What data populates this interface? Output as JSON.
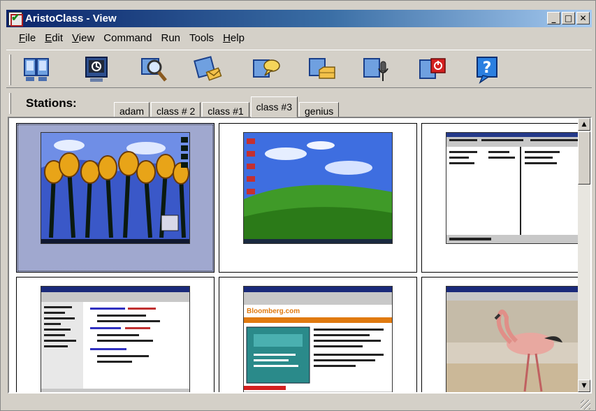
{
  "window": {
    "title": "AristoClass - View",
    "controls": {
      "minimize": "_",
      "maximize": "□",
      "close": "✕"
    }
  },
  "menu": [
    "File",
    "Edit",
    "View",
    "Command",
    "Run",
    "Tools",
    "Help"
  ],
  "toolbar": {
    "tools": [
      {
        "icon": "monitors-icon"
      },
      {
        "icon": "remote-control-icon"
      },
      {
        "icon": "magnifier-icon"
      },
      {
        "icon": "send-message-icon"
      },
      {
        "icon": "chat-icon"
      },
      {
        "icon": "send-files-icon"
      },
      {
        "icon": "audio-icon"
      },
      {
        "icon": "power-off-icon"
      },
      {
        "icon": "help-icon"
      }
    ]
  },
  "stations": {
    "label": "Stations:",
    "tabs": [
      "adam",
      "class # 2",
      "class #1",
      "class #3",
      "genius"
    ],
    "active_tab": "class #3"
  },
  "thumbnails": [
    {
      "screen": "tulip-desktop",
      "selected": true
    },
    {
      "screen": "bliss-desktop",
      "selected": false
    },
    {
      "screen": "file-manager",
      "selected": false
    },
    {
      "screen": "code-editor",
      "selected": false
    },
    {
      "screen": "bloomberg-browser",
      "selected": false
    },
    {
      "screen": "flamingo-photo",
      "selected": false
    }
  ],
  "browser_thumb": {
    "site": "Bloomberg.com"
  },
  "colors": {
    "title_start": "#0a246a",
    "title_end": "#a6caf0",
    "selected_cell": "#a0a8cf",
    "chrome": "#d4d0c8"
  }
}
